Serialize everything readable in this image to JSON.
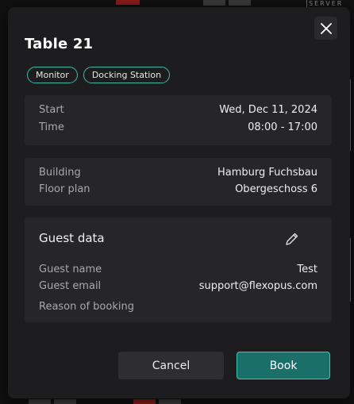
{
  "background": {
    "corner_text": "SERVER"
  },
  "modal": {
    "title": "Table 21",
    "tags": [
      "Monitor",
      "Docking Station"
    ],
    "schedule": {
      "start_label": "Start",
      "start_value": "Wed, Dec 11, 2024",
      "time_label": "Time",
      "time_value": "08:00 - 17:00"
    },
    "location": {
      "building_label": "Building",
      "building_value": "Hamburg Fuchsbau",
      "floor_label": "Floor plan",
      "floor_value": "Obergeschoss 6"
    },
    "guest": {
      "section_title": "Guest data",
      "name_label": "Guest name",
      "name_value": "Test",
      "email_label": "Guest email",
      "email_value": "support@flexopus.com",
      "reason_label": "Reason of booking",
      "reason_value": ""
    },
    "buttons": {
      "cancel": "Cancel",
      "book": "Book"
    },
    "icons": {
      "close": "close-icon",
      "edit": "pencil-icon"
    },
    "colors": {
      "accent": "#3fb8a8",
      "primary_button": "#1a6f69"
    }
  }
}
